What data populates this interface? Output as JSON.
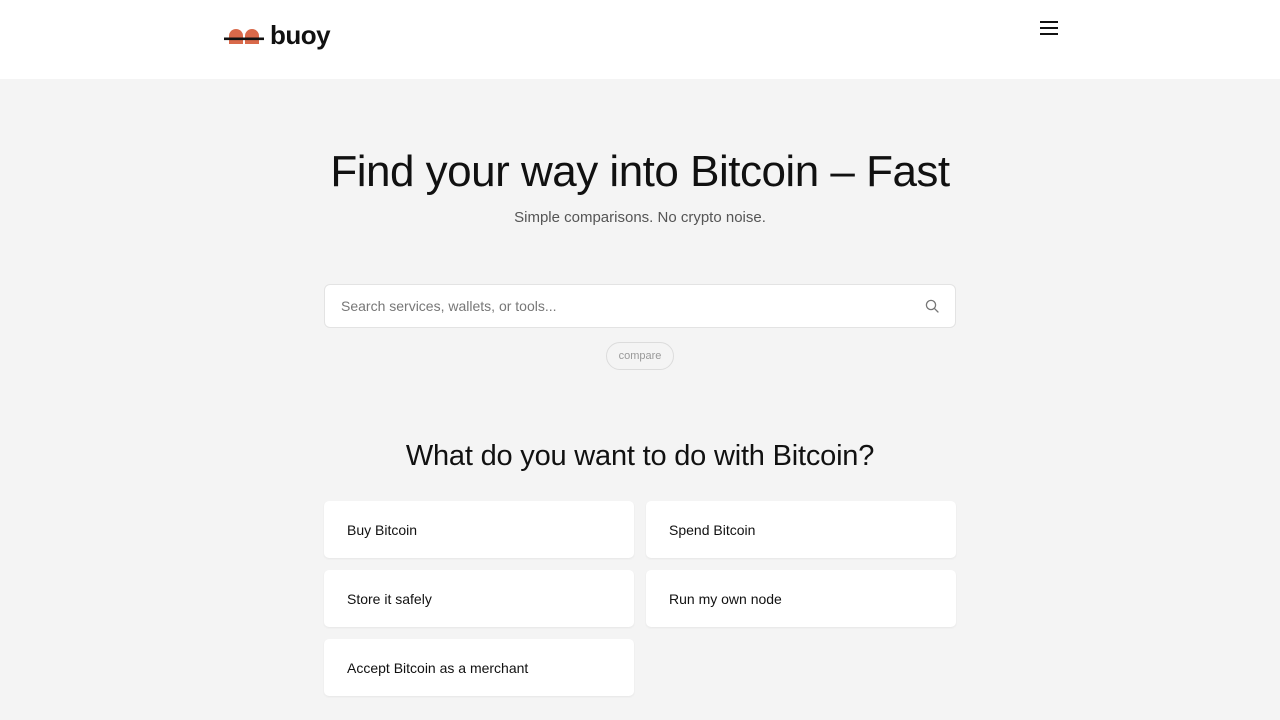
{
  "header": {
    "logo_text": "buoy",
    "menu_icon": "hamburger-menu-icon"
  },
  "hero": {
    "title": "Find your way into Bitcoin – Fast",
    "subtitle": "Simple comparisons. No crypto noise."
  },
  "search": {
    "placeholder": "Search services, wallets, or tools...",
    "value": "",
    "icon": "search-icon"
  },
  "tag": {
    "label": "compare"
  },
  "options": {
    "title": "What do you want to do with Bitcoin?",
    "items": [
      {
        "label": "Buy Bitcoin"
      },
      {
        "label": "Spend Bitcoin"
      },
      {
        "label": "Store it safely"
      },
      {
        "label": "Run my own node"
      },
      {
        "label": "Accept Bitcoin as a merchant"
      }
    ]
  },
  "colors": {
    "brand_accent": "#d9694a",
    "background": "#f4f4f4",
    "card": "#ffffff",
    "text": "#111111"
  }
}
